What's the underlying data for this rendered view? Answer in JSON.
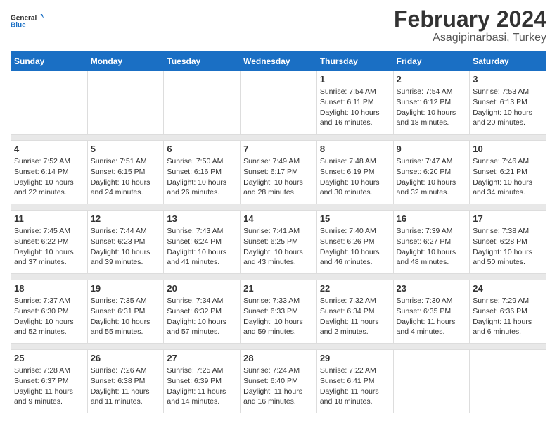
{
  "logo": {
    "text_general": "General",
    "text_blue": "Blue"
  },
  "title": "February 2024",
  "subtitle": "Asagipinarbasi, Turkey",
  "days_of_week": [
    "Sunday",
    "Monday",
    "Tuesday",
    "Wednesday",
    "Thursday",
    "Friday",
    "Saturday"
  ],
  "weeks": [
    [
      {
        "day": "",
        "info": ""
      },
      {
        "day": "",
        "info": ""
      },
      {
        "day": "",
        "info": ""
      },
      {
        "day": "",
        "info": ""
      },
      {
        "day": "1",
        "info": "Sunrise: 7:54 AM\nSunset: 6:11 PM\nDaylight: 10 hours\nand 16 minutes."
      },
      {
        "day": "2",
        "info": "Sunrise: 7:54 AM\nSunset: 6:12 PM\nDaylight: 10 hours\nand 18 minutes."
      },
      {
        "day": "3",
        "info": "Sunrise: 7:53 AM\nSunset: 6:13 PM\nDaylight: 10 hours\nand 20 minutes."
      }
    ],
    [
      {
        "day": "4",
        "info": "Sunrise: 7:52 AM\nSunset: 6:14 PM\nDaylight: 10 hours\nand 22 minutes."
      },
      {
        "day": "5",
        "info": "Sunrise: 7:51 AM\nSunset: 6:15 PM\nDaylight: 10 hours\nand 24 minutes."
      },
      {
        "day": "6",
        "info": "Sunrise: 7:50 AM\nSunset: 6:16 PM\nDaylight: 10 hours\nand 26 minutes."
      },
      {
        "day": "7",
        "info": "Sunrise: 7:49 AM\nSunset: 6:17 PM\nDaylight: 10 hours\nand 28 minutes."
      },
      {
        "day": "8",
        "info": "Sunrise: 7:48 AM\nSunset: 6:19 PM\nDaylight: 10 hours\nand 30 minutes."
      },
      {
        "day": "9",
        "info": "Sunrise: 7:47 AM\nSunset: 6:20 PM\nDaylight: 10 hours\nand 32 minutes."
      },
      {
        "day": "10",
        "info": "Sunrise: 7:46 AM\nSunset: 6:21 PM\nDaylight: 10 hours\nand 34 minutes."
      }
    ],
    [
      {
        "day": "11",
        "info": "Sunrise: 7:45 AM\nSunset: 6:22 PM\nDaylight: 10 hours\nand 37 minutes."
      },
      {
        "day": "12",
        "info": "Sunrise: 7:44 AM\nSunset: 6:23 PM\nDaylight: 10 hours\nand 39 minutes."
      },
      {
        "day": "13",
        "info": "Sunrise: 7:43 AM\nSunset: 6:24 PM\nDaylight: 10 hours\nand 41 minutes."
      },
      {
        "day": "14",
        "info": "Sunrise: 7:41 AM\nSunset: 6:25 PM\nDaylight: 10 hours\nand 43 minutes."
      },
      {
        "day": "15",
        "info": "Sunrise: 7:40 AM\nSunset: 6:26 PM\nDaylight: 10 hours\nand 46 minutes."
      },
      {
        "day": "16",
        "info": "Sunrise: 7:39 AM\nSunset: 6:27 PM\nDaylight: 10 hours\nand 48 minutes."
      },
      {
        "day": "17",
        "info": "Sunrise: 7:38 AM\nSunset: 6:28 PM\nDaylight: 10 hours\nand 50 minutes."
      }
    ],
    [
      {
        "day": "18",
        "info": "Sunrise: 7:37 AM\nSunset: 6:30 PM\nDaylight: 10 hours\nand 52 minutes."
      },
      {
        "day": "19",
        "info": "Sunrise: 7:35 AM\nSunset: 6:31 PM\nDaylight: 10 hours\nand 55 minutes."
      },
      {
        "day": "20",
        "info": "Sunrise: 7:34 AM\nSunset: 6:32 PM\nDaylight: 10 hours\nand 57 minutes."
      },
      {
        "day": "21",
        "info": "Sunrise: 7:33 AM\nSunset: 6:33 PM\nDaylight: 10 hours\nand 59 minutes."
      },
      {
        "day": "22",
        "info": "Sunrise: 7:32 AM\nSunset: 6:34 PM\nDaylight: 11 hours\nand 2 minutes."
      },
      {
        "day": "23",
        "info": "Sunrise: 7:30 AM\nSunset: 6:35 PM\nDaylight: 11 hours\nand 4 minutes."
      },
      {
        "day": "24",
        "info": "Sunrise: 7:29 AM\nSunset: 6:36 PM\nDaylight: 11 hours\nand 6 minutes."
      }
    ],
    [
      {
        "day": "25",
        "info": "Sunrise: 7:28 AM\nSunset: 6:37 PM\nDaylight: 11 hours\nand 9 minutes."
      },
      {
        "day": "26",
        "info": "Sunrise: 7:26 AM\nSunset: 6:38 PM\nDaylight: 11 hours\nand 11 minutes."
      },
      {
        "day": "27",
        "info": "Sunrise: 7:25 AM\nSunset: 6:39 PM\nDaylight: 11 hours\nand 14 minutes."
      },
      {
        "day": "28",
        "info": "Sunrise: 7:24 AM\nSunset: 6:40 PM\nDaylight: 11 hours\nand 16 minutes."
      },
      {
        "day": "29",
        "info": "Sunrise: 7:22 AM\nSunset: 6:41 PM\nDaylight: 11 hours\nand 18 minutes."
      },
      {
        "day": "",
        "info": ""
      },
      {
        "day": "",
        "info": ""
      }
    ]
  ]
}
